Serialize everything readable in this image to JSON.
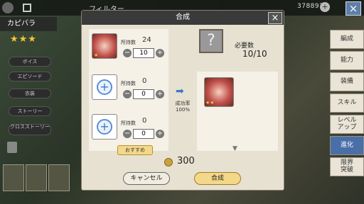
{
  "header": {
    "filter_label": "フィルター",
    "gold": "378897",
    "close_icon": "×"
  },
  "character": {
    "name": "カピバラ"
  },
  "skills": [
    "ボイス",
    "エピソード",
    "衣装",
    "ストーリー",
    "クロスストーリー"
  ],
  "right_tabs": [
    "編成",
    "能力",
    "装備",
    "スキル",
    "レベル\nアップ",
    "進化",
    "限界\n突破"
  ],
  "right_active": "進化",
  "modal": {
    "title": "合成",
    "close": "×",
    "materials": [
      {
        "own_label": "所持数",
        "own": "24",
        "qty": "10",
        "type": "gem"
      },
      {
        "own_label": "所持数",
        "own": "0",
        "qty": "0",
        "type": "empty"
      },
      {
        "own_label": "所持数",
        "own": "0",
        "qty": "0",
        "type": "empty"
      }
    ],
    "recommend": "おすすめ",
    "rate_label": "成功率",
    "rate_value": "100%",
    "required_label": "必要数",
    "required_value": "10/10",
    "cost": "300",
    "cancel": "キャンセル",
    "confirm": "合成"
  },
  "colors": {
    "accent": "#4a6ea8",
    "gold": "#f4d88a"
  }
}
